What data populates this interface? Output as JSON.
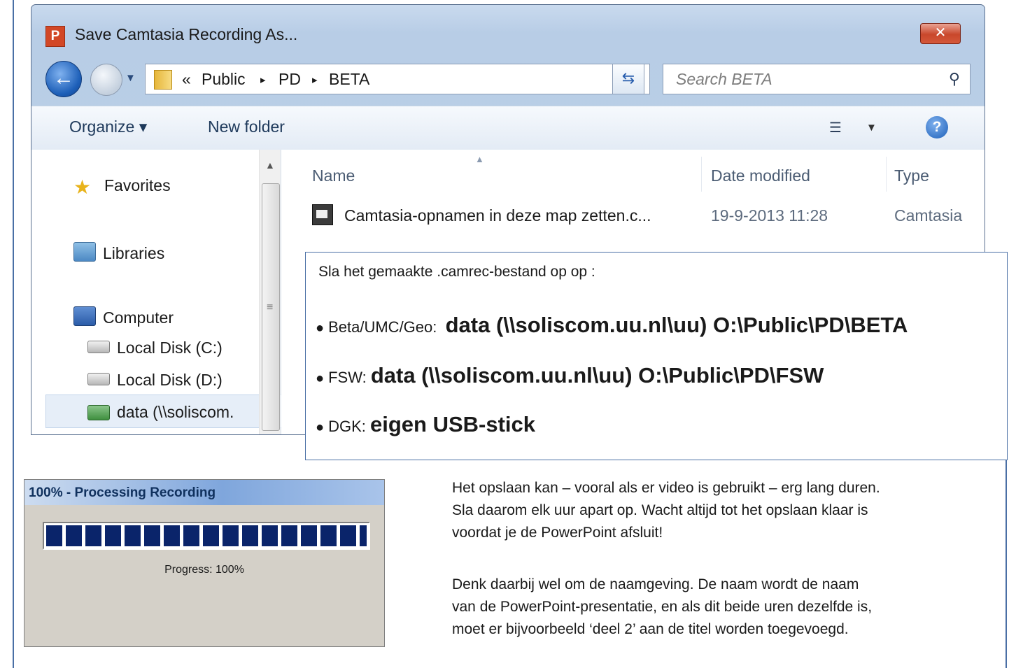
{
  "dialog": {
    "title": "Save Camtasia Recording As...",
    "app_icon_letter": "P",
    "close_label": "✕",
    "address": {
      "overflow": "«",
      "crumbs": [
        "Public",
        "PD",
        "BETA"
      ],
      "separator": "▸"
    },
    "search": {
      "placeholder": "Search BETA"
    },
    "toolbar": {
      "organize_label": "Organize ▾",
      "new_folder_label": "New folder"
    },
    "nav": {
      "favorites": "Favorites",
      "libraries": "Libraries",
      "computer": "Computer",
      "local_c": "Local Disk (C:)",
      "local_d": "Local Disk (D:)",
      "network_drive": "data (\\\\soliscom."
    },
    "columns": {
      "name": "Name",
      "date_modified": "Date modified",
      "type": "Type"
    },
    "files": [
      {
        "name": "Camtasia-opnamen in deze map zetten.c...",
        "date": "19-9-2013 11:28",
        "type": "Camtasia"
      }
    ]
  },
  "callout": {
    "intro": "Sla het gemaakte .camrec-bestand op op :",
    "bullets": [
      {
        "label": "Beta/UMC/Geo:",
        "path": "data (\\\\soliscom.uu.nl\\uu) O:\\Public\\PD\\BETA"
      },
      {
        "label": "FSW:",
        "path": "data (\\\\soliscom.uu.nl\\uu) O:\\Public\\PD\\FSW"
      },
      {
        "label": "DGK:",
        "path": "eigen USB-stick"
      }
    ]
  },
  "progress_window": {
    "title": "100% - Processing Recording",
    "progress_text": "Progress: 100%",
    "progress_fraction": 1.0
  },
  "explanation": {
    "para1_lines": [
      "Het opslaan kan – vooral als er video is gebruikt – erg lang duren.",
      "Sla daarom elk uur apart op. Wacht altijd tot het opslaan klaar is",
      "voordat je de PowerPoint afsluit!"
    ],
    "para2_lines": [
      "Denk daarbij wel om de naamgeving. De naam wordt de naam",
      "van de PowerPoint-presentatie, en als dit beide uren dezelfde is,",
      "moet er bijvoorbeeld ‘deel 2’ aan de titel worden toegevoegd."
    ]
  },
  "colors": {
    "frame": "#4a6fa5",
    "progress_fill": "#0a246a",
    "close_red": "#c9472b"
  }
}
